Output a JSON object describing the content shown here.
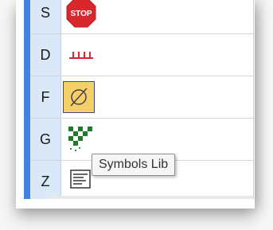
{
  "rows": [
    {
      "key": "S",
      "symbol": "stop-sign-icon"
    },
    {
      "key": "D",
      "symbol": "dashed-line-icon"
    },
    {
      "key": "F",
      "symbol": "empty-set-icon"
    },
    {
      "key": "G",
      "symbol": "checker-pattern-icon"
    },
    {
      "key": "Z",
      "symbol": "form-icon"
    }
  ],
  "stop_sign_text": "STOP",
  "tooltip": "Symbols Lib",
  "colors": {
    "accent": "#3f85e0",
    "key_background": "#dbe8f8",
    "selected_background": "#f5d06a",
    "stop_red": "#d9272e",
    "checker_green": "#1f7a2a"
  }
}
